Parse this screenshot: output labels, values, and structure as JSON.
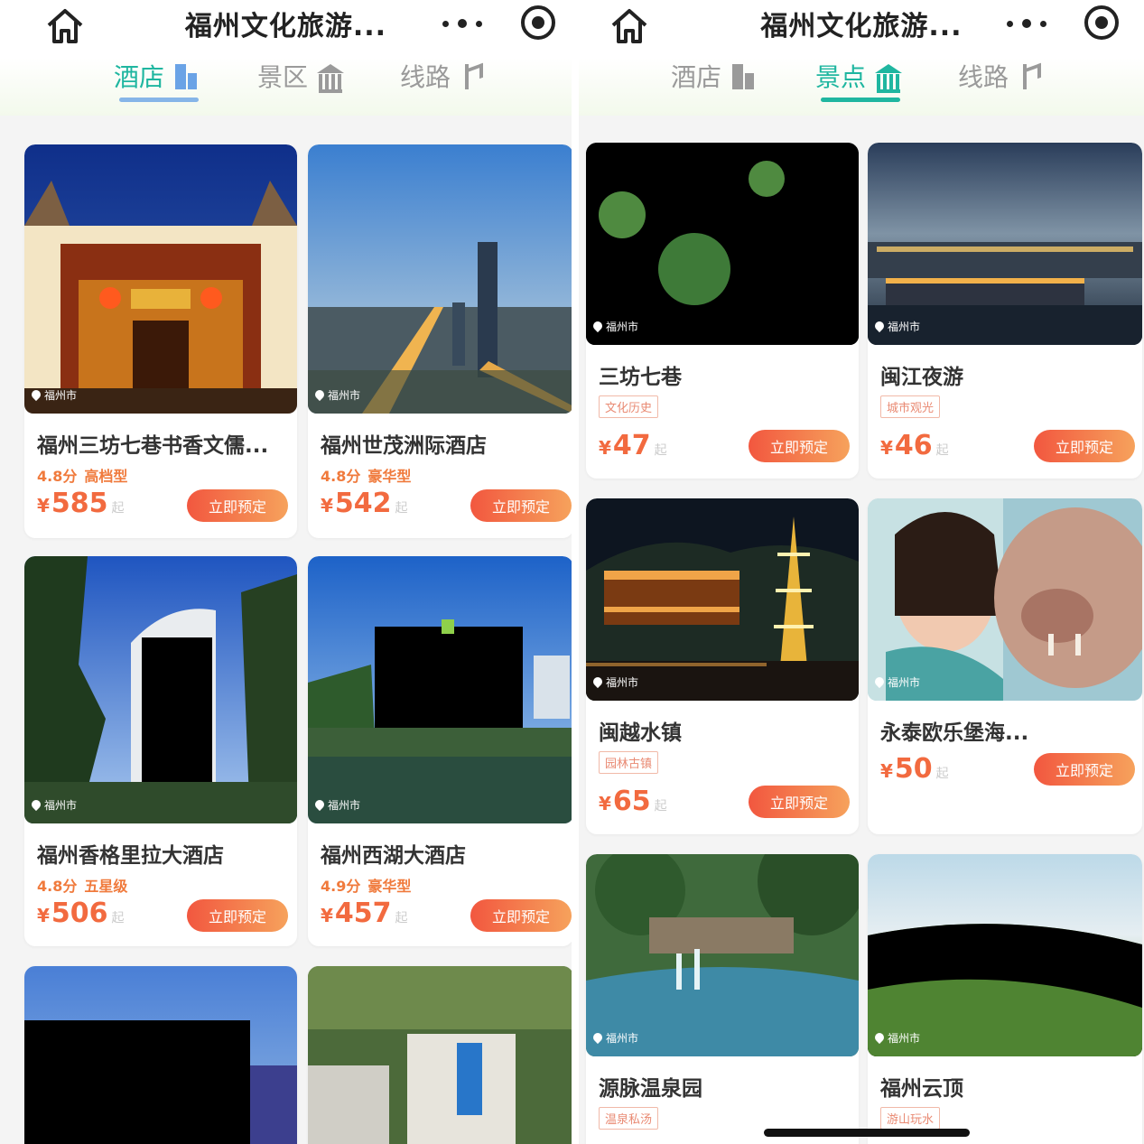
{
  "left": {
    "header": {
      "title": "福州文化旅游..."
    },
    "tabs": [
      {
        "label": "酒店",
        "active": true
      },
      {
        "label": "景区",
        "active": false
      },
      {
        "label": "线路",
        "active": false
      }
    ],
    "cards": [
      {
        "name": "福州三坊七巷书香文儒...",
        "rating": "4.8分",
        "grade": "高档型",
        "currency": "¥",
        "price": "585",
        "suffix": "起",
        "location": "福州市",
        "book": "立即预定"
      },
      {
        "name": "福州世茂洲际酒店",
        "rating": "4.8分",
        "grade": "豪华型",
        "currency": "¥",
        "price": "542",
        "suffix": "起",
        "location": "福州市",
        "book": "立即预定"
      },
      {
        "name": "福州香格里拉大酒店",
        "rating": "4.8分",
        "grade": "五星级",
        "currency": "¥",
        "price": "506",
        "suffix": "起",
        "location": "福州市",
        "book": "立即预定"
      },
      {
        "name": "福州西湖大酒店",
        "rating": "4.9分",
        "grade": "豪华型",
        "currency": "¥",
        "price": "457",
        "suffix": "起",
        "location": "福州市",
        "book": "立即预定"
      }
    ]
  },
  "right": {
    "header": {
      "title": "福州文化旅游..."
    },
    "tabs": [
      {
        "label": "酒店",
        "active": false
      },
      {
        "label": "景点",
        "active": true
      },
      {
        "label": "线路",
        "active": false
      }
    ],
    "cards": [
      {
        "name": "三坊七巷",
        "tag": "文化历史",
        "currency": "¥",
        "price": "47",
        "suffix": "起",
        "location": "福州市",
        "book": "立即预定"
      },
      {
        "name": "闽江夜游",
        "tag": "城市观光",
        "currency": "¥",
        "price": "46",
        "suffix": "起",
        "location": "福州市",
        "book": "立即预定"
      },
      {
        "name": "闽越水镇",
        "tag": "园林古镇",
        "currency": "¥",
        "price": "65",
        "suffix": "起",
        "location": "福州市",
        "book": "立即预定"
      },
      {
        "name": "永泰欧乐堡海...",
        "currency": "¥",
        "price": "50",
        "suffix": "起",
        "location": "福州市",
        "book": "立即预定"
      },
      {
        "name": "源脉温泉园",
        "tag": "温泉私汤",
        "location": "福州市"
      },
      {
        "name": "福州云顶",
        "tag": "游山玩水",
        "location": "福州市"
      }
    ]
  },
  "colors": {
    "accent": "#1fb6a0",
    "price": "#f26a3f",
    "book_start": "#f2573f",
    "book_end": "#f6a25c"
  }
}
